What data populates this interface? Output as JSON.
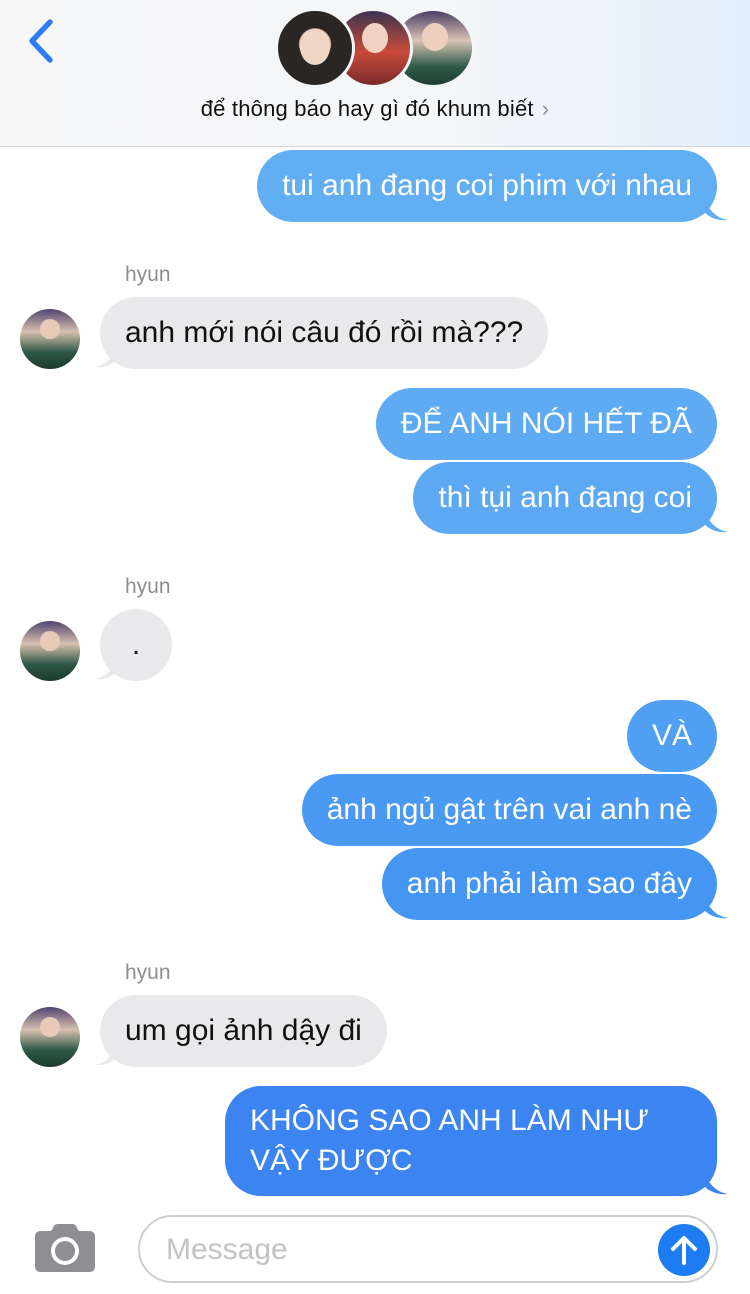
{
  "header": {
    "group_name": "để thông báo hay gì đó khum biết",
    "chevron": "›"
  },
  "sender_name": "hyun",
  "messages": [
    {
      "id": "m1",
      "dir": "out",
      "text": "tui anh đang coi phim với nhau",
      "color": "#62aef3"
    },
    {
      "id": "m2",
      "dir": "in",
      "text": "anh mới nói câu đó rồi mà???"
    },
    {
      "id": "m3",
      "dir": "out",
      "text": "ĐỂ ANH NÓI HẾT ĐÃ",
      "color": "#5fabf3"
    },
    {
      "id": "m4",
      "dir": "out",
      "text": "thì tụi anh đang coi",
      "color": "#5da8f3"
    },
    {
      "id": "m5",
      "dir": "in",
      "text": "."
    },
    {
      "id": "m6",
      "dir": "out",
      "text": "VÀ",
      "color": "#4f9ff2"
    },
    {
      "id": "m7",
      "dir": "out",
      "text": "ảnh ngủ gật trên vai anh nè",
      "color": "#4a99f2"
    },
    {
      "id": "m8",
      "dir": "out",
      "text": "anh phải làm sao đây",
      "color": "#4596f2"
    },
    {
      "id": "m9",
      "dir": "in",
      "text": "um gọi ảnh dậy đi"
    },
    {
      "id": "m10",
      "dir": "out",
      "text": "KHÔNG SAO ANH LÀM NHƯ VẬY ĐƯỢC",
      "color": "#3b84f1"
    }
  ],
  "composer": {
    "placeholder": "Message"
  },
  "colors": {
    "incoming_bubble": "#e9e9eb",
    "send_button": "#1e7cf2",
    "back_arrow": "#2f7cf6"
  },
  "icons": {
    "back": "chevron-left-icon",
    "camera": "camera-icon",
    "send": "arrow-up-icon"
  }
}
